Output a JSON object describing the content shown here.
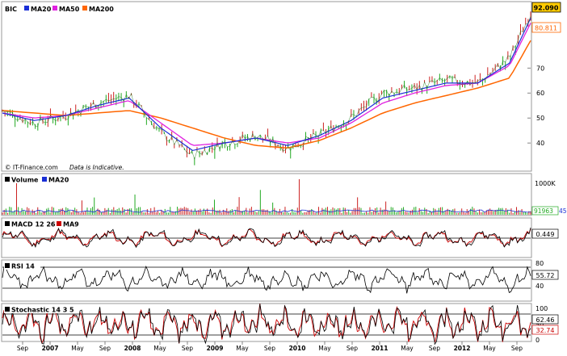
{
  "chart_data": [
    {
      "panel": "price",
      "type": "line",
      "legend": [
        {
          "label": "BIC",
          "color": "#000000"
        },
        {
          "label": "MA20",
          "color": "#1a2fd6"
        },
        {
          "label": "MA50",
          "color": "#e020e0"
        },
        {
          "label": "MA200",
          "color": "#ff6600"
        }
      ],
      "ylim": [
        31,
        94
      ],
      "yticks": [
        40,
        50,
        60,
        70
      ],
      "last_price_label": "92.090",
      "ma200_label": "80.811",
      "credit": "© IT-Finance.com",
      "note": "Data is Indicative.",
      "x_positions": [
        0,
        6,
        12,
        18,
        24,
        30,
        36,
        42,
        48,
        54,
        60,
        66,
        72,
        78,
        84,
        90,
        96,
        100
      ],
      "close": [
        53,
        48,
        51,
        56,
        59,
        44,
        35,
        40,
        43,
        38,
        43,
        50,
        60,
        62,
        65,
        64,
        74,
        92
      ],
      "ma20": [
        52,
        49,
        51,
        55,
        58,
        46,
        37,
        40,
        42,
        39,
        43,
        49,
        58,
        61,
        64,
        64,
        72,
        90
      ],
      "ma50": [
        52,
        50,
        51,
        54,
        57,
        48,
        39,
        40,
        42,
        40,
        42,
        48,
        56,
        60,
        63,
        64,
        71,
        88
      ],
      "ma200": [
        53,
        52,
        51,
        52,
        53,
        50,
        46,
        42,
        39,
        38,
        41,
        46,
        52,
        56,
        59,
        62,
        66,
        81
      ]
    },
    {
      "panel": "volume",
      "type": "bar",
      "legend": [
        {
          "label": "Volume",
          "color": "#000000"
        },
        {
          "label": "MA20",
          "color": "#1a2fd6"
        }
      ],
      "ytick_label": "1000K",
      "last_value_label": "91963",
      "ma_value_label": "45"
    },
    {
      "panel": "macd",
      "type": "line",
      "legend": [
        {
          "label": "MACD 12 26",
          "color": "#000000"
        },
        {
          "label": "MA9",
          "color": "#cc0000"
        }
      ],
      "value_label": "0.449"
    },
    {
      "panel": "rsi",
      "type": "line",
      "legend": [
        {
          "label": "RSI 14",
          "color": "#000000"
        }
      ],
      "yticks": [
        40,
        80
      ],
      "value_label": "55.72"
    },
    {
      "panel": "stochastic",
      "type": "line",
      "legend": [
        {
          "label": "Stochastic 14 3 5",
          "color": "#000000"
        }
      ],
      "yticks": [
        0,
        50,
        100
      ],
      "value_label_1": "62.46",
      "value_label_2": "32.74"
    }
  ],
  "x_axis": {
    "labels": [
      "Sep",
      "2007",
      "May",
      "Sep",
      "2008",
      "May",
      "Sep",
      "2009",
      "May",
      "Sep",
      "2010",
      "May",
      "Sep",
      "2011",
      "May",
      "Sep",
      "2012",
      "May",
      "Sep"
    ]
  },
  "colors": {
    "up": "#22aa22",
    "down": "#cc2222",
    "frame": "#999999",
    "value_box_price": "#ffcc00"
  }
}
